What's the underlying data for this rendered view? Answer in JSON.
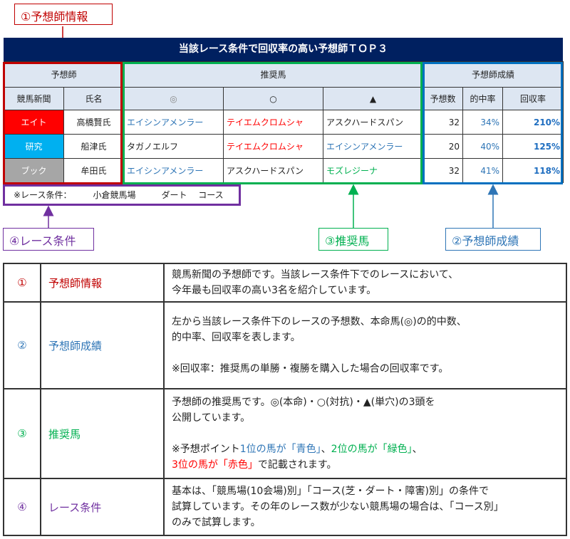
{
  "callouts": {
    "c1": "①予想師情報",
    "c2": "②予想師成績",
    "c3": "③推奨馬",
    "c4": "④レース条件"
  },
  "colors": {
    "red": "#c00000",
    "blue": "#2e75b6",
    "green": "#00b050",
    "purple": "#7030a0",
    "navy": "#002060"
  },
  "title": "当該レース条件で回収率の高い予想師ＴＯＰ３",
  "table": {
    "group_headers": {
      "predictor": "予想師",
      "horses": "推奨馬",
      "results": "予想師成績"
    },
    "columns": {
      "paper": "競馬新聞",
      "name": "氏名",
      "honmei": "◎",
      "taikou": "○",
      "tanana": "▲",
      "count": "予想数",
      "hit_rate": "的中率",
      "return_rate": "回収率"
    },
    "rows": [
      {
        "paper": "エイト",
        "name": "高橋賢氏",
        "honmei": "エイシンアメンラー",
        "taikou": "テイエムクロムシャ",
        "tanana": "アスクハードスパン",
        "count": "32",
        "hit_rate": "34%",
        "return_rate": "210%"
      },
      {
        "paper": "研究",
        "name": "船津氏",
        "honmei": "タガノエルフ",
        "taikou": "テイエムクロムシャ",
        "tanana": "エイシンアメンラー",
        "count": "20",
        "hit_rate": "40%",
        "return_rate": "125%"
      },
      {
        "paper": "ブック",
        "name": "牟田氏",
        "honmei": "エイシンアメンラー",
        "taikou": "アスクハードスパン",
        "tanana": "モズレジーナ",
        "count": "32",
        "hit_rate": "41%",
        "return_rate": "118%"
      }
    ]
  },
  "race_condition": "※レース条件：　　　小倉競馬場　　　ダート　 コース",
  "legend": [
    {
      "num": "①",
      "term": "予想師情報",
      "lines": [
        "競馬新聞の予想師です。当該レース条件下でのレースにおいて、",
        "今年最も回収率の高い3名を紹介しています。"
      ]
    },
    {
      "num": "②",
      "term": "予想師成績",
      "lines": [
        "左から当該レース条件下のレースの予想数、本命馬(◎)の的中数、",
        "的中率、回収率を表します。",
        "※回収率：推奨馬の単勝・複勝を購入した場合の回収率です。"
      ]
    },
    {
      "num": "③",
      "term": "推奨馬",
      "lines": [
        "予想師の推奨馬です。◎(本命)・○(対抗)・▲(単穴)の3頭を",
        "公開しています。"
      ],
      "note": {
        "prefix": "※予想ポイント",
        "blue": "1位の馬が「青色」",
        "sep": "、",
        "green": "2位の馬が「緑色」",
        "sep2": "、",
        "red": "3位の馬が「赤色」",
        "suffix": "で記載されます。"
      }
    },
    {
      "num": "④",
      "term": "レース条件",
      "lines": [
        "基本は、「競馬場(10会場)別」「コース(芝・ダート・障害)別」の条件で",
        "試算しています。その年のレース数が少ない競馬場の場合は、「コース別」",
        "のみで試算します。"
      ]
    }
  ]
}
